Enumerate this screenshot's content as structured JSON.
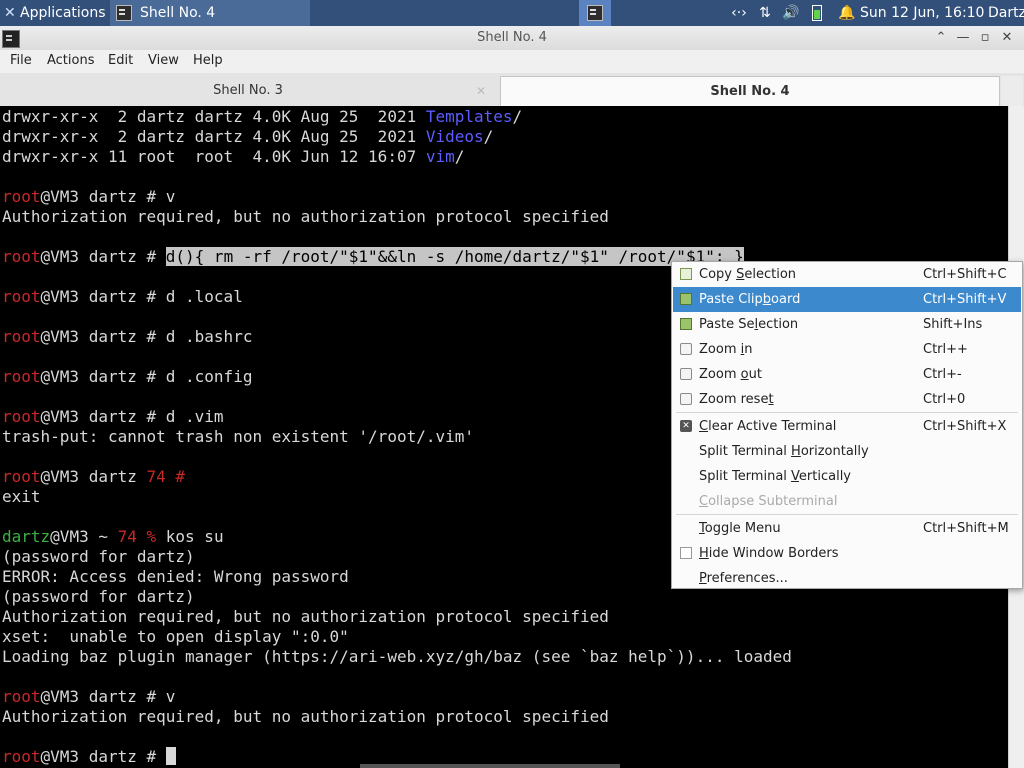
{
  "panel": {
    "applications": "Applications",
    "task_title": "Shell No. 4",
    "tray_network": "‹·›",
    "tray_arrows": "⇅",
    "tray_volume": "🔊",
    "tray_bell": "🔔",
    "clock": "Sun 12 Jun, 16:10",
    "user": "Dartz"
  },
  "window": {
    "title": "Shell No. 4",
    "btn_up": "⌃",
    "btn_min": "—",
    "btn_max": "▫",
    "btn_close": "✕"
  },
  "menubar": [
    "File",
    "Actions",
    "Edit",
    "View",
    "Help"
  ],
  "tabs": [
    {
      "label": "Shell No. 3",
      "close": "✕"
    },
    {
      "label": "Shell No. 4"
    }
  ],
  "terminal": {
    "lines": [
      [
        {
          "t": "drwxr-xr-x  2 dartz dartz 4.0K Aug 25  2021 "
        },
        {
          "t": "Templates",
          "c": "blue"
        },
        {
          "t": "/"
        }
      ],
      [
        {
          "t": "drwxr-xr-x  2 dartz dartz 4.0K Aug 25  2021 "
        },
        {
          "t": "Videos",
          "c": "blue"
        },
        {
          "t": "/"
        }
      ],
      [
        {
          "t": "drwxr-xr-x 11 root  root  4.0K Jun 12 16:07 "
        },
        {
          "t": "vim",
          "c": "blue"
        },
        {
          "t": "/"
        }
      ],
      [],
      [
        {
          "t": "root",
          "c": "red"
        },
        {
          "t": "@VM3 dartz # v"
        }
      ],
      [
        {
          "t": "Authorization required, but no authorization protocol specified"
        }
      ],
      [],
      [
        {
          "t": "root",
          "c": "red"
        },
        {
          "t": "@VM3 dartz # "
        },
        {
          "t": "d(){ rm -rf /root/\"$1\"&&ln -s /home/dartz/\"$1\" /root/\"$1\"; }",
          "c": "sel"
        }
      ],
      [],
      [
        {
          "t": "root",
          "c": "red"
        },
        {
          "t": "@VM3 dartz # d .local"
        }
      ],
      [],
      [
        {
          "t": "root",
          "c": "red"
        },
        {
          "t": "@VM3 dartz # d .bashrc"
        }
      ],
      [],
      [
        {
          "t": "root",
          "c": "red"
        },
        {
          "t": "@VM3 dartz # d .config"
        }
      ],
      [],
      [
        {
          "t": "root",
          "c": "red"
        },
        {
          "t": "@VM3 dartz # d .vim"
        }
      ],
      [
        {
          "t": "trash-put: cannot trash non existent '/root/.vim'"
        }
      ],
      [],
      [
        {
          "t": "root",
          "c": "red"
        },
        {
          "t": "@VM3 dartz "
        },
        {
          "t": "74 #",
          "c": "red"
        }
      ],
      [
        {
          "t": "exit"
        }
      ],
      [],
      [
        {
          "t": "dartz",
          "c": "green"
        },
        {
          "t": "@VM3 ~ "
        },
        {
          "t": "74 %",
          "c": "red"
        },
        {
          "t": " kos su"
        }
      ],
      [
        {
          "t": "(password for dartz)"
        }
      ],
      [
        {
          "t": "ERROR: Access denied: Wrong password"
        }
      ],
      [
        {
          "t": "(password for dartz)"
        }
      ],
      [
        {
          "t": "Authorization required, but no authorization protocol specified"
        }
      ],
      [
        {
          "t": "xset:  unable to open display \":0.0\""
        }
      ],
      [
        {
          "t": "Loading baz plugin manager (https://ari-web.xyz/gh/baz (see `baz help`))... loaded"
        }
      ],
      [],
      [
        {
          "t": "root",
          "c": "red"
        },
        {
          "t": "@VM3 dartz # v"
        }
      ],
      [
        {
          "t": "Authorization required, but no authorization protocol specified"
        }
      ],
      [],
      [
        {
          "t": "root",
          "c": "red"
        },
        {
          "t": "@VM3 dartz # "
        },
        {
          "cursor": true
        }
      ]
    ]
  },
  "context_menu": {
    "copy_selection": {
      "pre": "Copy ",
      "u": "S",
      "post": "election",
      "shortcut": "Ctrl+Shift+C"
    },
    "paste_clipboard": {
      "pre": "Paste Clip",
      "u": "b",
      "post": "oard",
      "shortcut": "Ctrl+Shift+V"
    },
    "paste_selection": {
      "pre": "Paste Se",
      "u": "l",
      "post": "ection",
      "shortcut": "Shift+Ins"
    },
    "zoom_in": {
      "pre": "Zoom ",
      "u": "i",
      "post": "n",
      "shortcut": "Ctrl++"
    },
    "zoom_out": {
      "pre": "Zoom ",
      "u": "o",
      "post": "ut",
      "shortcut": "Ctrl+-"
    },
    "zoom_reset": {
      "pre": "Zoom rese",
      "u": "t",
      "post": "",
      "shortcut": "Ctrl+0"
    },
    "clear_terminal": {
      "pre": "",
      "u": "C",
      "post": "lear Active Terminal",
      "shortcut": "Ctrl+Shift+X"
    },
    "split_h": {
      "pre": "Split Terminal ",
      "u": "H",
      "post": "orizontally"
    },
    "split_v": {
      "pre": "Split Terminal ",
      "u": "V",
      "post": "ertically"
    },
    "collapse": {
      "pre": "",
      "u": "C",
      "post": "ollapse Subterminal"
    },
    "toggle_menu": {
      "pre": "",
      "u": "T",
      "post": "oggle Menu",
      "shortcut": "Ctrl+Shift+M"
    },
    "hide_borders": {
      "pre": "",
      "u": "H",
      "post": "ide Window Borders"
    },
    "preferences": {
      "pre": "",
      "u": "P",
      "post": "references..."
    }
  }
}
